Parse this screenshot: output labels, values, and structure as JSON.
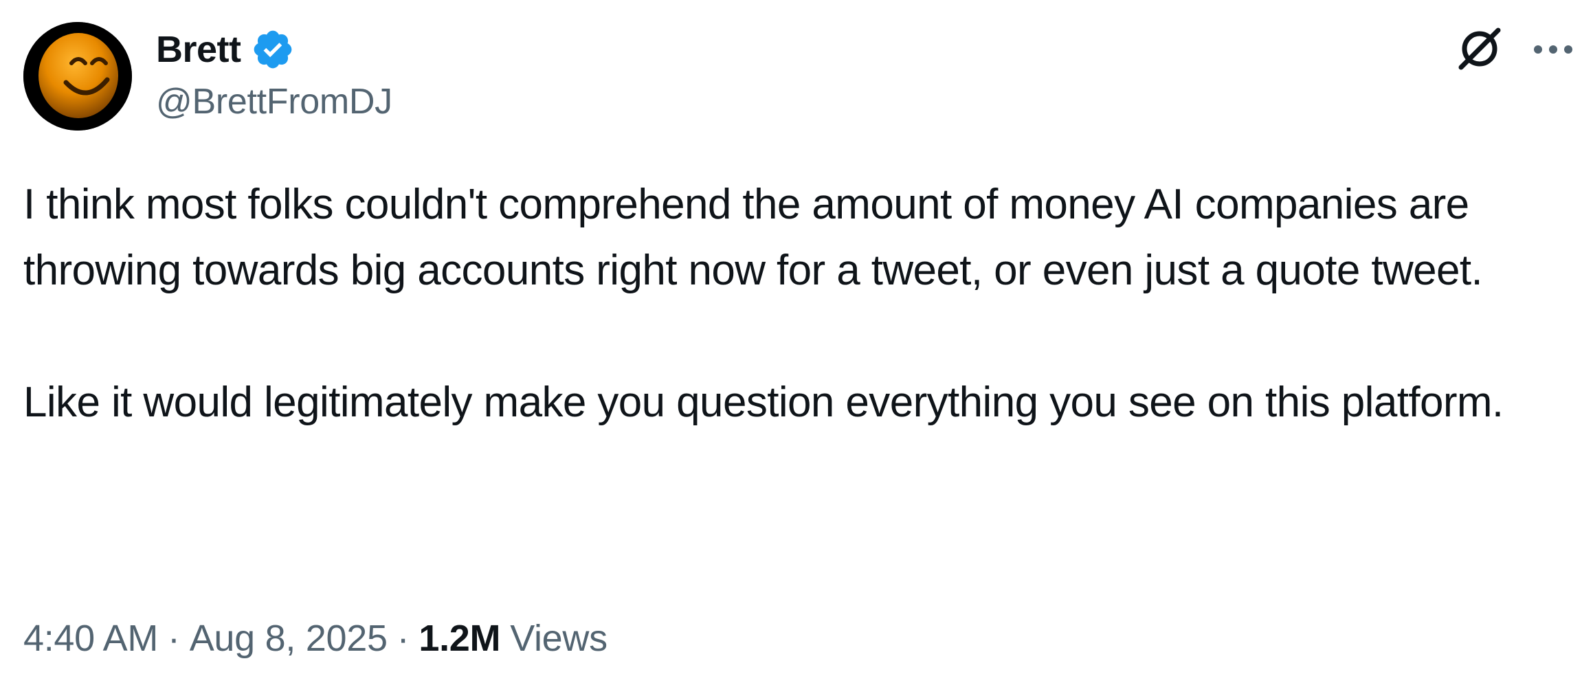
{
  "author": {
    "display_name": "Brett",
    "handle": "@BrettFromDJ",
    "verified": true
  },
  "tweet": {
    "paragraphs": [
      "I think most folks couldn't comprehend the amount of money AI companies are throwing towards big accounts right now for a tweet, or even just a quote tweet.",
      "Like it would legitimately make you question everything you see on this platform."
    ],
    "time": "4:40 AM",
    "date": "Aug 8, 2025",
    "separator": "·",
    "views_count": "1.2M",
    "views_label": "Views"
  },
  "icons": {
    "verified": "verified-badge-icon",
    "grok": "grok-icon",
    "more": "more-options-icon"
  },
  "colors": {
    "text_primary": "#0f1419",
    "text_secondary": "#536471",
    "verified_blue": "#1d9bf0"
  }
}
